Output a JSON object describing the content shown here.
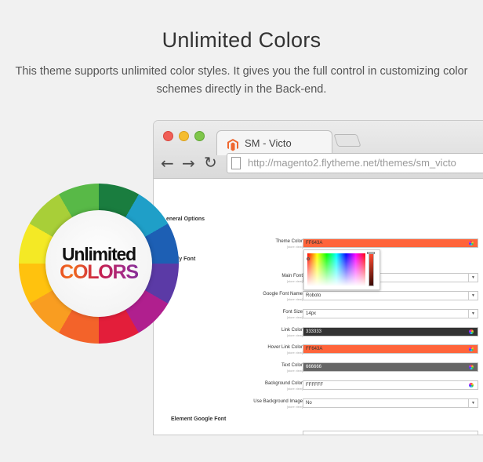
{
  "promo": {
    "headline": "Unlimited Colors",
    "intro": "This theme supports unlimited color styles. It gives you the full control in customizing color schemes directly in the Back-end."
  },
  "browser": {
    "tab_title": "SM - Victo",
    "url": "http://magento2.flytheme.net/themes/sm_victo",
    "icons": [
      "back-arrow-icon",
      "forward-arrow-icon",
      "reload-icon",
      "page-icon",
      "magento-logo-icon"
    ]
  },
  "admin": {
    "general_options": "eneral Options",
    "body_font": "dy Font",
    "element_google_font": "Element Google Font",
    "scope_label": "[store view]",
    "rows": {
      "theme_color": {
        "label": "Theme Color",
        "value": "FF643A",
        "bg": "#ff643a"
      },
      "main_font": {
        "label": "Main Font",
        "value": ""
      },
      "google_font_name": {
        "label": "Google Font Name",
        "value": "Roboto"
      },
      "font_size": {
        "label": "Font Size",
        "value": "14px"
      },
      "link_color": {
        "label": "Link Color",
        "value": "333333",
        "bg": "#333333"
      },
      "hover_link_color": {
        "label": "Hover Link Color",
        "value": "FF643A",
        "bg": "#ff643a"
      },
      "text_color": {
        "label": "Text Color",
        "value": "666666",
        "bg": "#666666"
      },
      "background_color": {
        "label": "Background Color",
        "value": "FFFFFF",
        "bg": "#ffffff"
      },
      "use_background_image": {
        "label": "Use Background Image",
        "value": "No"
      }
    }
  },
  "badge": {
    "line1": "Unlimited",
    "line2": "COLORS"
  }
}
